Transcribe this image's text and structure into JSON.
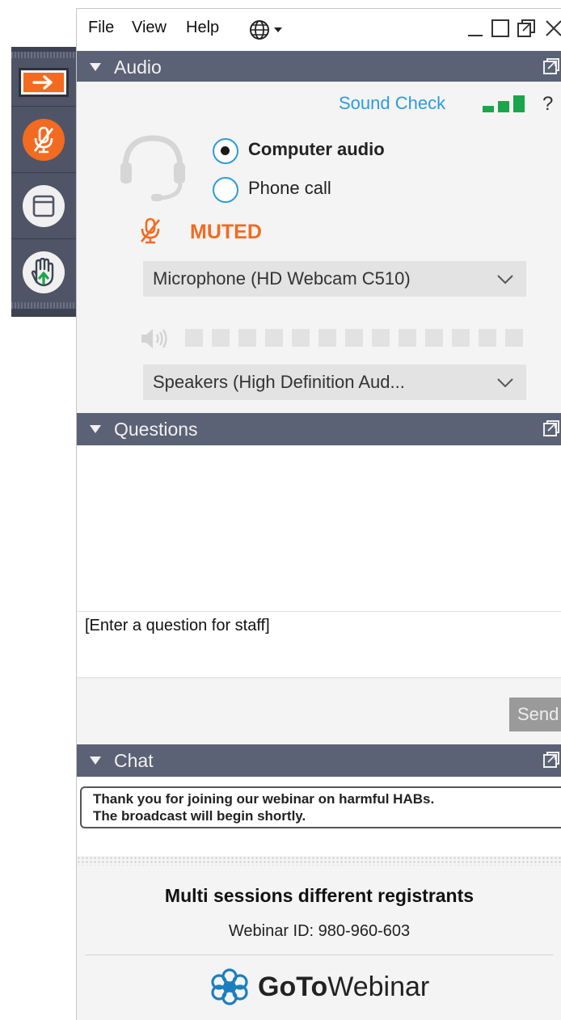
{
  "menubar": {
    "items": [
      "File",
      "View",
      "Help"
    ],
    "language_icon": "globe-icon",
    "window_controls": [
      "minimize-icon",
      "maximize-icon",
      "restore-icon",
      "close-icon"
    ]
  },
  "sidebar": {
    "buttons": [
      {
        "name": "collapse-panel-button",
        "icon": "arrow-right-icon"
      },
      {
        "name": "mute-toggle-button",
        "icon": "muted-microphone-icon"
      },
      {
        "name": "screen-view-button",
        "icon": "window-icon"
      },
      {
        "name": "raise-hand-button",
        "icon": "hand-icon"
      }
    ]
  },
  "audio": {
    "title": "Audio",
    "sound_check": "Sound Check",
    "help": "?",
    "options": [
      {
        "label": "Computer audio",
        "selected": true
      },
      {
        "label": "Phone call",
        "selected": false
      }
    ],
    "muted_label": "MUTED",
    "microphone": "Microphone (HD Webcam C510)",
    "speakers": "Speakers (High Definition Aud...",
    "level_segments": 13,
    "signal_bars": 3
  },
  "questions": {
    "title": "Questions",
    "placeholder": "[Enter a question for staff]",
    "send_label": "Send"
  },
  "chat": {
    "title": "Chat",
    "message_line1": "Thank you for joining our webinar on harmful HABs.",
    "message_line2": "The broadcast will begin shortly."
  },
  "footer": {
    "session_title": "Multi sessions different registrants",
    "webinar_id": "Webinar ID: 980-960-603",
    "brand_bold": "GoTo",
    "brand_regular": "Webinar"
  },
  "colors": {
    "header_bg": "#5c6275",
    "accent_orange": "#f26b21",
    "link_blue": "#2d9cdb",
    "signal_green": "#1aa64a"
  }
}
